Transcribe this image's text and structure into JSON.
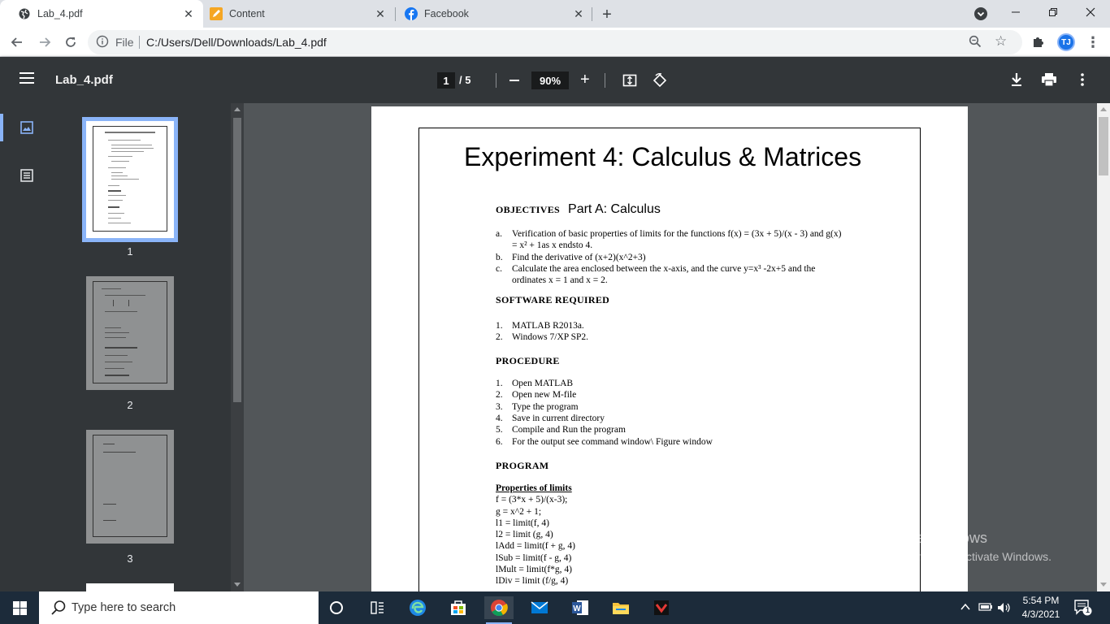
{
  "browser": {
    "tabs": [
      {
        "title": "Lab_4.pdf",
        "active": true
      },
      {
        "title": "Content",
        "active": false
      },
      {
        "title": "Facebook",
        "active": false
      }
    ],
    "address": {
      "scheme": "File",
      "url": "C:/Users/Dell/Downloads/Lab_4.pdf"
    },
    "profile_initials": "TJ",
    "accent": "#1a73e8"
  },
  "pdf_viewer": {
    "title": "Lab_4.pdf",
    "current_page": "1",
    "total_pages": "/ 5",
    "zoom": "90%",
    "thumbnails": [
      {
        "label": "1"
      },
      {
        "label": "2"
      },
      {
        "label": "3"
      }
    ]
  },
  "document": {
    "title": "Experiment 4: Calculus & Matrices",
    "objectives_heading": "OBJECTIVES",
    "part_a": "Part A: Calculus",
    "objectives": [
      {
        "label": "a.",
        "line1": "Verification of basic properties of limits for the functions f(x) = (3x + 5)/(x - 3) and g(x)",
        "line2": "= x² + 1as x endsto 4."
      },
      {
        "label": "b.",
        "line1": "Find the derivative of (x+2)(x^2+3)",
        "line2": ""
      },
      {
        "label": "c.",
        "line1": "Calculate the area enclosed between the x-axis, and the curve y=x³ -2x+5 and the",
        "line2": "ordinates x = 1 and x = 2."
      }
    ],
    "software_heading": "SOFTWARE REQUIRED",
    "software": [
      {
        "label": "1.",
        "text": "MATLAB R2013a."
      },
      {
        "label": "2.",
        "text": "Windows 7/XP SP2."
      }
    ],
    "procedure_heading": "PROCEDURE",
    "procedure": [
      {
        "label": "1.",
        "text": "Open MATLAB"
      },
      {
        "label": "2.",
        "text": "Open new M-file"
      },
      {
        "label": "3.",
        "text": "Type the program"
      },
      {
        "label": "4.",
        "text": "Save in current directory"
      },
      {
        "label": "5.",
        "text": "Compile and Run the program"
      },
      {
        "label": "6.",
        "text": "For the output see command window\\ Figure window"
      }
    ],
    "program_heading": "PROGRAM",
    "program_subheading": "Properties of limits",
    "code": [
      "f = (3*x + 5)/(x-3);",
      "g = x^2 + 1;",
      "l1 = limit(f, 4)",
      "l2 = limit (g, 4)",
      "lAdd = limit(f + g, 4)",
      "lSub = limit(f - g, 4)",
      "lMult = limit(f*g, 4)",
      "lDiv = limit (f/g, 4)"
    ]
  },
  "watermark": {
    "line1": "Activate Windows",
    "line2": "Go to Settings to activate Windows."
  },
  "taskbar": {
    "search_placeholder": "Type here to search",
    "time": "5:54 PM",
    "date": "4/3/2021",
    "notification_count": "1"
  }
}
